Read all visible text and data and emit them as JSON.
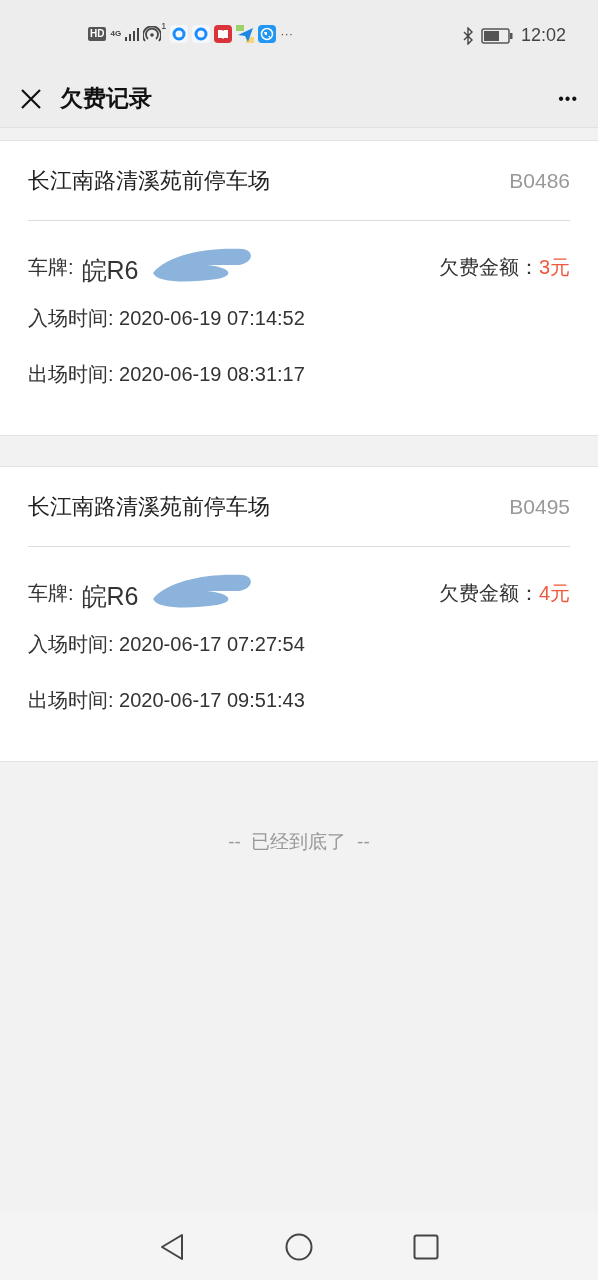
{
  "status_bar": {
    "badge": "HD",
    "network": "4G",
    "hotspot_count": "1",
    "more": "···",
    "time": "12:02"
  },
  "header": {
    "title": "欠费记录",
    "menu": "•••"
  },
  "records": [
    {
      "lot": "长江南路清溪苑前停车场",
      "code": "B0486",
      "plate_label": "车牌:",
      "plate": "皖R6",
      "amount_label": "欠费金额：",
      "amount": "3元",
      "entry": "入场时间: 2020-06-19 07:14:52",
      "exit": "出场时间: 2020-06-19 08:31:17"
    },
    {
      "lot": "长江南路清溪苑前停车场",
      "code": "B0495",
      "plate_label": "车牌:",
      "plate": "皖R6",
      "amount_label": "欠费金额：",
      "amount": "4元",
      "entry": "入场时间: 2020-06-17 07:27:54",
      "exit": "出场时间: 2020-06-17 09:51:43"
    }
  ],
  "footer": "--  已经到底了  --"
}
